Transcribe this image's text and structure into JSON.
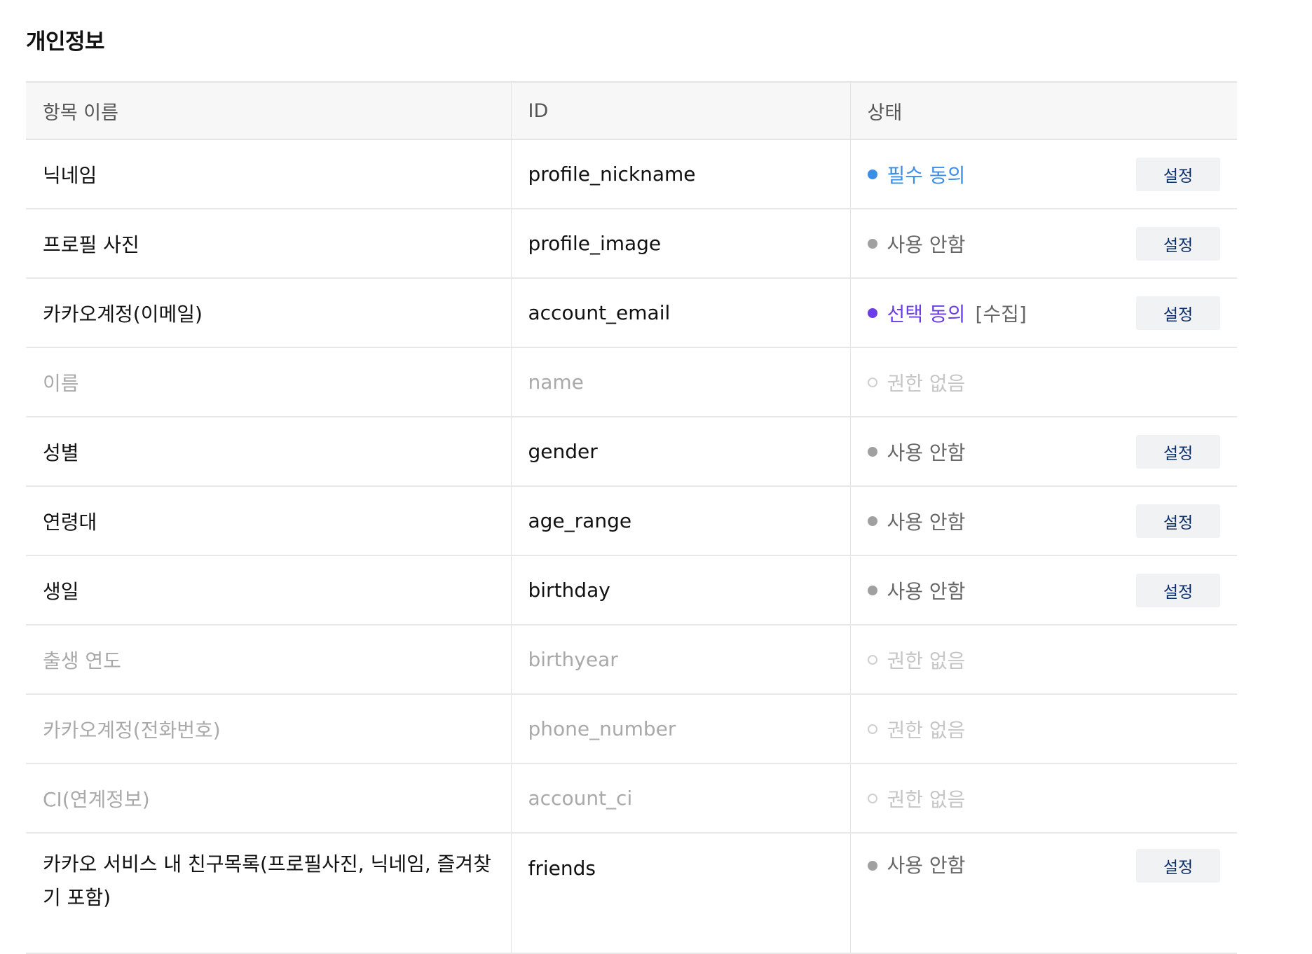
{
  "section": {
    "title": "개인정보"
  },
  "table": {
    "headers": {
      "name": "항목 이름",
      "id": "ID",
      "status": "상태"
    },
    "rows": [
      {
        "name": "닉네임",
        "id": "profile_nickname",
        "status": "필수 동의",
        "status_type": "required",
        "note": "",
        "action": "설정",
        "enabled": true
      },
      {
        "name": "프로필 사진",
        "id": "profile_image",
        "status": "사용 안함",
        "status_type": "unused",
        "note": "",
        "action": "설정",
        "enabled": true
      },
      {
        "name": "카카오계정(이메일)",
        "id": "account_email",
        "status": "선택 동의",
        "status_type": "optional",
        "note": "[수집]",
        "action": "설정",
        "enabled": true
      },
      {
        "name": "이름",
        "id": "name",
        "status": "권한 없음",
        "status_type": "none",
        "note": "",
        "action": "",
        "enabled": false
      },
      {
        "name": "성별",
        "id": "gender",
        "status": "사용 안함",
        "status_type": "unused",
        "note": "",
        "action": "설정",
        "enabled": true
      },
      {
        "name": "연령대",
        "id": "age_range",
        "status": "사용 안함",
        "status_type": "unused",
        "note": "",
        "action": "설정",
        "enabled": true
      },
      {
        "name": "생일",
        "id": "birthday",
        "status": "사용 안함",
        "status_type": "unused",
        "note": "",
        "action": "설정",
        "enabled": true
      },
      {
        "name": "출생 연도",
        "id": "birthyear",
        "status": "권한 없음",
        "status_type": "none",
        "note": "",
        "action": "",
        "enabled": false
      },
      {
        "name": "카카오계정(전화번호)",
        "id": "phone_number",
        "status": "권한 없음",
        "status_type": "none",
        "note": "",
        "action": "",
        "enabled": false
      },
      {
        "name": "CI(연계정보)",
        "id": "account_ci",
        "status": "권한 없음",
        "status_type": "none",
        "note": "",
        "action": "",
        "enabled": false
      },
      {
        "name": "카카오 서비스 내 친구목록(프로필사진, 닉네임, 즐겨찾기 포함)",
        "id": "friends",
        "status": "사용 안함",
        "status_type": "unused",
        "note": "",
        "action": "설정",
        "enabled": true
      }
    ]
  },
  "colors": {
    "required": "#3a8ee6",
    "optional": "#6a3de8",
    "unused": "#a0a0a0",
    "none": "#cfcfcf",
    "button_text": "#0b2e6b",
    "button_bg": "#f1f2f4"
  }
}
